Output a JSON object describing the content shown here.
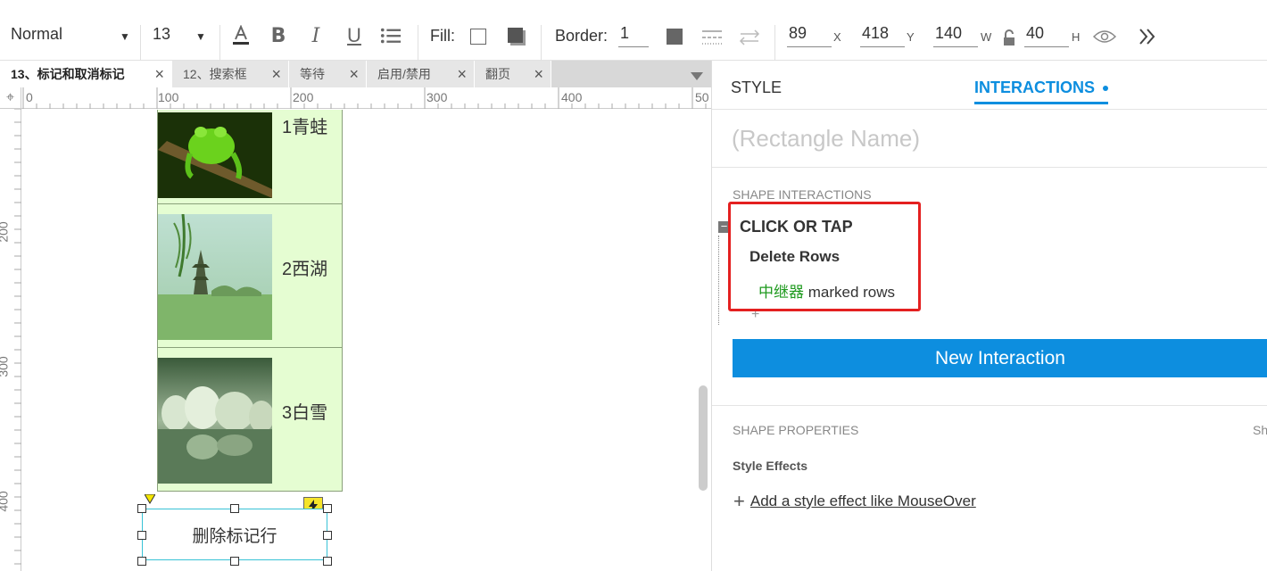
{
  "toolbar": {
    "style_select": "Normal",
    "font_size": "13",
    "fill_label": "Fill:",
    "border_label": "Border:",
    "border_value": "1",
    "x_value": "89",
    "x_label": "X",
    "y_value": "418",
    "y_label": "Y",
    "w_value": "140",
    "w_label": "W",
    "h_value": "40",
    "h_label": "H"
  },
  "tabs": [
    {
      "label": "13、标记和取消标记",
      "active": true
    },
    {
      "label": "12、搜索框",
      "active": false
    },
    {
      "label": "等待",
      "active": false
    },
    {
      "label": "启用/禁用",
      "active": false
    },
    {
      "label": "翻页",
      "active": false
    }
  ],
  "ruler": {
    "h_labels": [
      "0",
      "100",
      "200",
      "300",
      "400",
      "50"
    ],
    "v_labels": [
      "200",
      "300",
      "400"
    ]
  },
  "canvas": {
    "rows": [
      {
        "label": "1青蛙"
      },
      {
        "label": "2西湖"
      },
      {
        "label": "3白雪"
      }
    ],
    "delete_button": "删除标记行"
  },
  "panel": {
    "style_tab": "STYLE",
    "interactions_tab": "INTERACTIONS",
    "name_placeholder": "(Rectangle Name)",
    "shape_interactions_title": "SHAPE INTERACTIONS",
    "event": "CLICK OR TAP",
    "action": "Delete Rows",
    "target_name": "中继器",
    "target_rest": "marked rows",
    "new_interaction": "New Interaction",
    "shape_properties_title": "SHAPE PROPERTIES",
    "shape_properties_right": "Sh",
    "style_effects_title": "Style Effects",
    "add_style_effect": "Add a style effect like MouseOver"
  },
  "colors": {
    "accent": "#0d8edf",
    "highlight": "#e42020",
    "repeater_bg": "#e5fdd2",
    "selection": "#38c2d6",
    "target_green": "#1f9a1f"
  }
}
